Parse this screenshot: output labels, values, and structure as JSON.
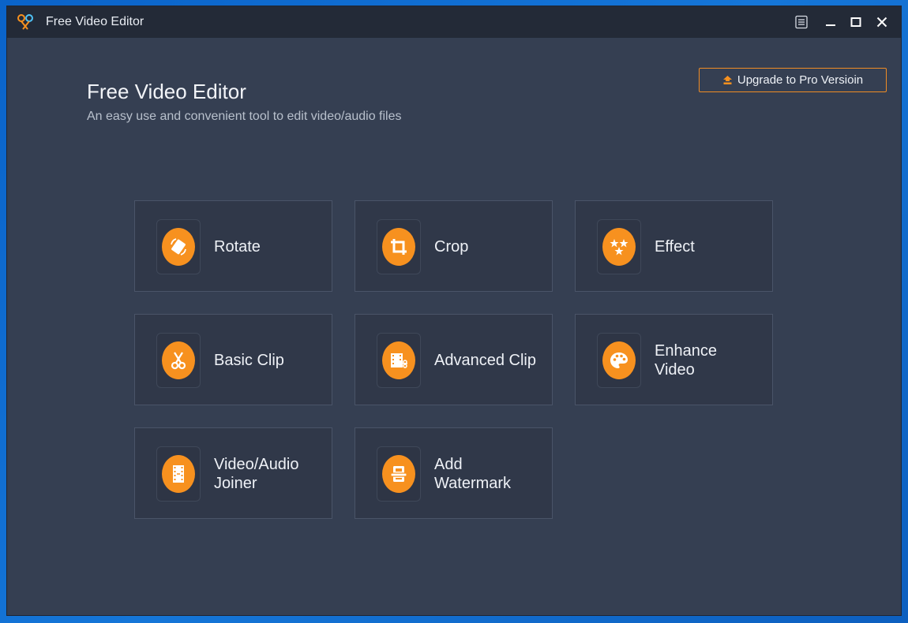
{
  "window": {
    "title": "Free Video Editor",
    "controls": {
      "menu_icon": "menu-list-icon",
      "minimize_icon": "minimize-icon",
      "maximize_icon": "maximize-icon",
      "close_icon": "close-icon"
    }
  },
  "header": {
    "title": "Free Video Editor",
    "subtitle": "An easy use and convenient tool to edit video/audio files",
    "upgrade_label": "Upgrade to Pro Versioin"
  },
  "colors": {
    "accent": "#f7911f",
    "window_bg": "#353f52",
    "titlebar_bg": "#232a37",
    "tile_bg": "#303849"
  },
  "tools": [
    {
      "label": "Rotate",
      "icon": "rotate-icon"
    },
    {
      "label": "Crop",
      "icon": "crop-icon"
    },
    {
      "label": "Effect",
      "icon": "effect-stars-icon"
    },
    {
      "label": "Basic Clip",
      "icon": "scissors-icon"
    },
    {
      "label": "Advanced Clip",
      "icon": "film-scissors-icon"
    },
    {
      "label": "Enhance\nVideo",
      "icon": "palette-icon"
    },
    {
      "label": "Video/Audio\nJoiner",
      "icon": "film-joiner-icon"
    },
    {
      "label": "Add\nWatermark",
      "icon": "watermark-icon"
    }
  ]
}
